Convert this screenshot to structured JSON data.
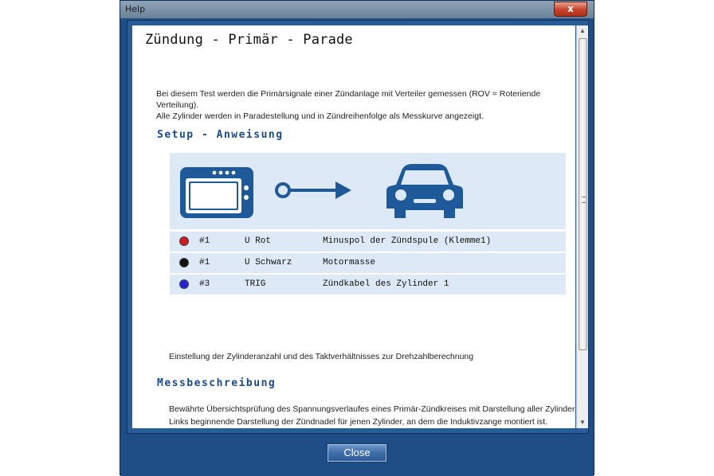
{
  "window": {
    "title": "Help",
    "close_glyph": "x"
  },
  "page": {
    "title": "Zündung - Primär - Parade",
    "intro_line1": "Bei diesem Test werden die Primärsignale einer Zündanlage mit Verteiler gemessen (ROV = Roteriende Verteilung).",
    "intro_line2": "Alle Zylinder werden in Paradestellung und in Zündreihenfolge als Messkurve angezeigt."
  },
  "setup": {
    "heading": "Setup - Anweisung",
    "icons": [
      "scan-tool-device-icon",
      "probe-arrow-icon",
      "car-front-icon"
    ],
    "connections": [
      {
        "color": "#d21a1a",
        "channel": "#1",
        "signal": "U Rot",
        "description": "Minuspol der Zündspule (Klemme1)"
      },
      {
        "color": "#111111",
        "channel": "#1",
        "signal": "U Schwarz",
        "description": "Motormasse"
      },
      {
        "color": "#2424d6",
        "channel": "#3",
        "signal": "TRIG",
        "description": "Zündkabel des Zylinder 1"
      }
    ],
    "note": "Einstellung der Zylinderanzahl und des Taktverhältnisses zur Drehzahlberechnung"
  },
  "measure": {
    "heading": "Messbeschreibung",
    "line1": "Bewährte Übersichtsprüfung des Spannungsverlaufes eines Primär-Zündkreises mit Darstellung aller Zylinder in Paradestell",
    "line2": "Links beginnende Darstellung der Zündnadel für jenen Zylinder, an dem die Induktivzange montiert ist."
  },
  "footer": {
    "close_label": "Close"
  },
  "colors": {
    "accent": "#1a4a8a",
    "panel": "#dde9f7",
    "window": "#1f4e86"
  }
}
